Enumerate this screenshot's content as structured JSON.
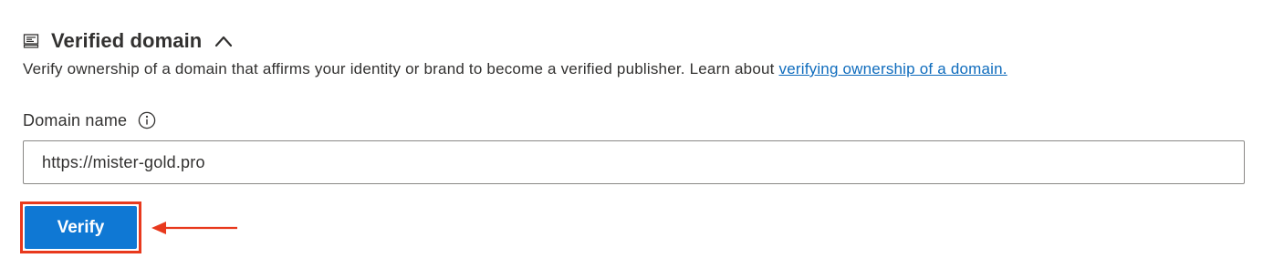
{
  "section": {
    "icon": "server-icon",
    "title": "Verified domain",
    "toggle_icon": "chevron-up-icon"
  },
  "description": {
    "text": "Verify ownership of a domain that affirms your identity or brand to become a verified publisher. Learn about ",
    "link_text": "verifying ownership of a domain."
  },
  "domain_field": {
    "label": "Domain name",
    "info_icon": "info-icon",
    "value": "https://mister-gold.pro"
  },
  "verify_button": {
    "label": "Verify"
  },
  "annotation": {
    "highlight_icon": "red-highlight-box",
    "arrow_icon": "red-arrow-left-icon"
  },
  "colors": {
    "primary": "#0f78d4",
    "link": "#0f6cbd",
    "annotation": "#e8391d",
    "text": "#323130",
    "input_border": "#8a8886"
  }
}
